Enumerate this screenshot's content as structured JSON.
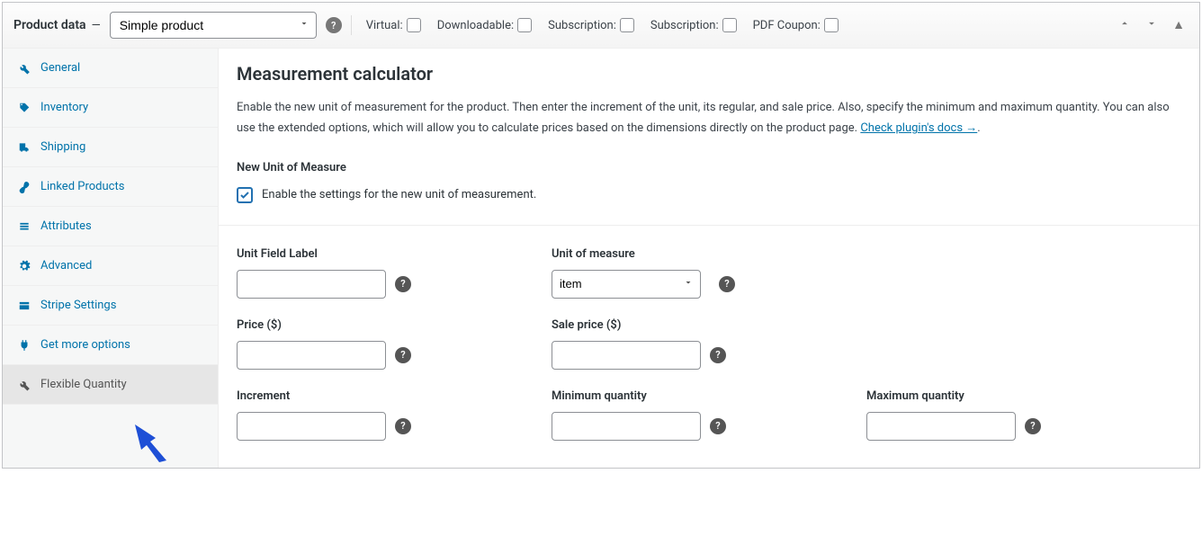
{
  "header": {
    "title": "Product data",
    "dash": "—",
    "product_type": "Simple product",
    "checks": [
      {
        "label": "Virtual:"
      },
      {
        "label": "Downloadable:"
      },
      {
        "label": "Subscription:"
      },
      {
        "label": "Subscription:"
      },
      {
        "label": "PDF Coupon:"
      }
    ]
  },
  "sidebar": {
    "tabs": [
      {
        "label": "General",
        "icon": "wrench"
      },
      {
        "label": "Inventory",
        "icon": "tag"
      },
      {
        "label": "Shipping",
        "icon": "truck"
      },
      {
        "label": "Linked Products",
        "icon": "link"
      },
      {
        "label": "Attributes",
        "icon": "list"
      },
      {
        "label": "Advanced",
        "icon": "gear"
      },
      {
        "label": "Stripe Settings",
        "icon": "card"
      },
      {
        "label": "Get more options",
        "icon": "plug"
      },
      {
        "label": "Flexible Quantity",
        "icon": "wrench"
      }
    ]
  },
  "content": {
    "heading": "Measurement calculator",
    "desc_1": "Enable the new unit of measurement for the product. Then enter the increment of the unit, its regular, and sale price. Also, specify the minimum and maximum quantity. You can also use the extended options, which will allow you to calculate prices based on the dimensions directly on the product page. ",
    "docs_link": "Check plugin's docs →",
    "section_sub": "New Unit of Measure",
    "enable_label": "Enable the settings for the new unit of measurement.",
    "fields": {
      "unit_field_label": "Unit Field Label",
      "unit_of_measure": "Unit of measure",
      "unit_of_measure_value": "item",
      "price": "Price ($)",
      "sale_price": "Sale price ($)",
      "increment": "Increment",
      "min_qty": "Minimum quantity",
      "max_qty": "Maximum quantity"
    }
  }
}
